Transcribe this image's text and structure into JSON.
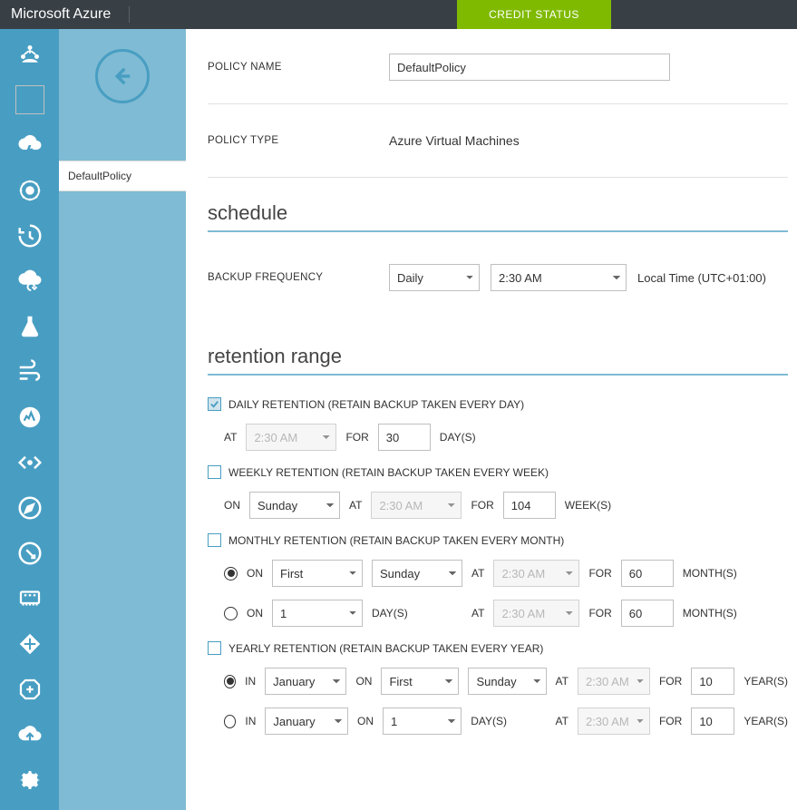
{
  "topbar": {
    "brand": "Microsoft Azure",
    "credit_status": "CREDIT STATUS"
  },
  "blade1": {
    "selected_item": "DefaultPolicy"
  },
  "policy": {
    "name_label": "POLICY NAME",
    "name_value": "DefaultPolicy",
    "type_label": "POLICY TYPE",
    "type_value": "Azure Virtual Machines"
  },
  "schedule": {
    "title": "schedule",
    "freq_label": "BACKUP FREQUENCY",
    "frequency": "Daily",
    "time": "2:30 AM",
    "timezone": "Local Time (UTC+01:00)"
  },
  "retention": {
    "title": "retention range",
    "daily": {
      "header": "DAILY RETENTION (RETAIN BACKUP TAKEN EVERY DAY)",
      "at_label": "AT",
      "time": "2:30 AM",
      "for_label": "FOR",
      "count": "30",
      "unit": "DAY(S)"
    },
    "weekly": {
      "header": "WEEKLY RETENTION (RETAIN BACKUP TAKEN EVERY WEEK)",
      "on_label": "ON",
      "day": "Sunday",
      "at_label": "AT",
      "time": "2:30 AM",
      "for_label": "FOR",
      "count": "104",
      "unit": "WEEK(S)"
    },
    "monthly": {
      "header": "MONTHLY RETENTION (RETAIN BACKUP TAKEN EVERY MONTH)",
      "row1": {
        "on_label": "ON",
        "ordinal": "First",
        "day": "Sunday",
        "at_label": "AT",
        "time": "2:30 AM",
        "for_label": "FOR",
        "count": "60",
        "unit": "MONTH(S)"
      },
      "row2": {
        "on_label": "ON",
        "dom": "1",
        "day_unit": "DAY(S)",
        "at_label": "AT",
        "time": "2:30 AM",
        "for_label": "FOR",
        "count": "60",
        "unit": "MONTH(S)"
      }
    },
    "yearly": {
      "header": "YEARLY RETENTION (RETAIN BACKUP TAKEN EVERY YEAR)",
      "row1": {
        "in_label": "IN",
        "month": "January",
        "on_label": "ON",
        "ordinal": "First",
        "day": "Sunday",
        "at_label": "AT",
        "time": "2:30 AM",
        "for_label": "FOR",
        "count": "10",
        "unit": "YEAR(S)"
      },
      "row2": {
        "in_label": "IN",
        "month": "January",
        "on_label": "ON",
        "dom": "1",
        "day_unit": "DAY(S)",
        "at_label": "AT",
        "time": "2:30 AM",
        "for_label": "FOR",
        "count": "10",
        "unit": "YEAR(S)"
      }
    }
  }
}
